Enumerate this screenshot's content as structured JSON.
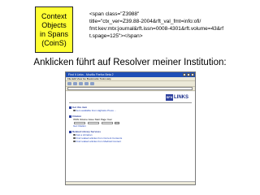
{
  "coins_box": {
    "lines": [
      "Context",
      "Objects",
      "in Spans",
      "(CoinS)"
    ]
  },
  "code_snippet": {
    "lines": [
      "<span class=\"Z3988\"",
      "title=\"ctx_ver=Z39.88-2004&rft_val_fmt=info:ofi/",
      "fmt:kev:mtx:journal&rft.issn=0008-4301&rft.volume=43&rf",
      "t.spage=125\"></span>"
    ]
  },
  "caption": "Anklicken führt auf Resolver meiner Institution:",
  "browser": {
    "title": "Find It Links - Mozilla Firefox Beta 2",
    "menu": "File  Edit  View  Go  Bookmarks  Tools  Help",
    "address": "",
    "banner_text": "",
    "logo_mark": "SFX",
    "logo_text": "LINKS",
    "sections": [
      {
        "title": "Get this item",
        "rows": [
          "Item available from Highwire Press ..."
        ]
      },
      {
        "title": "Citation",
        "rows": [
          "ISSN  Volume  Issue  Start Page  Year",
          "Get Citation"
        ]
      },
      {
        "title": "Related Library Services",
        "rows": [
          "Ask a Librarian",
          "Find related articles from Current Contents",
          "Find related articles from Medical Content"
        ]
      }
    ]
  }
}
